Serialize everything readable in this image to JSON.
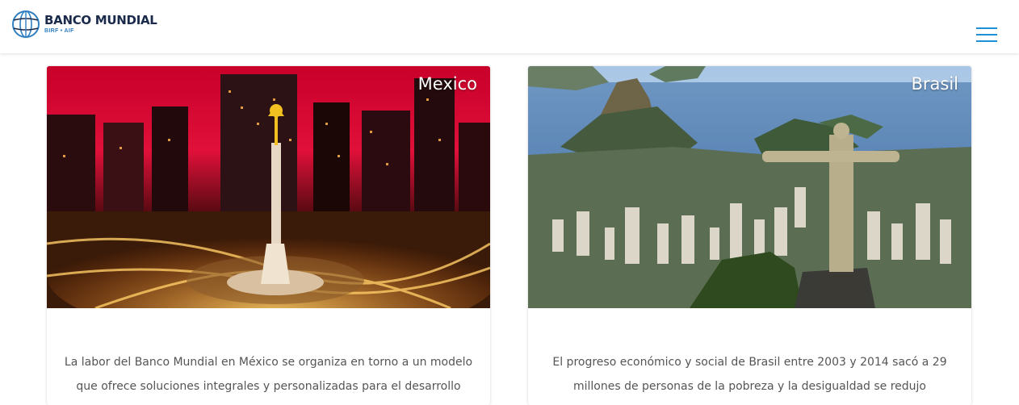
{
  "header": {
    "logo_name": "BANCO MUNDIAL",
    "logo_sub": "BIRF • AIF",
    "menu_icon": "hamburger-menu-icon"
  },
  "cards": [
    {
      "title": "Mexico",
      "text": "La labor del Banco Mundial en México se organiza en torno a un modelo que ofrece soluciones integrales y personalizadas para el desarrollo mediante un"
    },
    {
      "title": "Brasil",
      "text": "El progreso económico y social de Brasil entre 2003 y 2014 sacó a 29 millones de personas de la pobreza y la desigualdad se redujo significativamente."
    }
  ],
  "colors": {
    "brand_navy": "#1a2a4a",
    "brand_blue": "#2f7fc1",
    "menu_blue": "#1f8fd8",
    "body_text": "#555555"
  }
}
